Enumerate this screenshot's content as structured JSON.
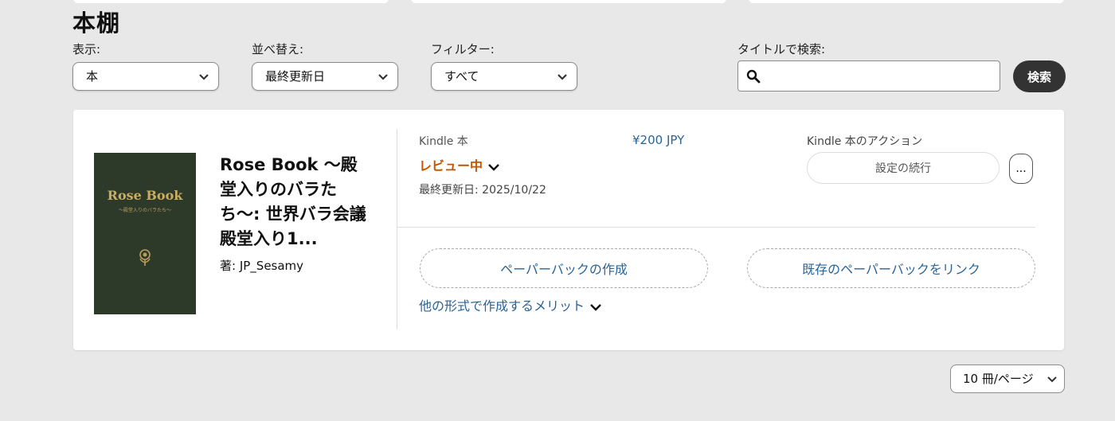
{
  "page_title": "本棚",
  "filters": {
    "display_label": "表示:",
    "display_value": "本",
    "sort_label": "並べ替え:",
    "sort_value": "最終更新日",
    "filter_label": "フィルター:",
    "filter_value": "すべて",
    "search_label": "タイトルで検索:",
    "search_value": "",
    "search_button": "検索"
  },
  "book": {
    "cover_title": "Rose Book",
    "cover_subtitle": "〜殿堂入りのバラたち〜",
    "title": "Rose Book 〜殿堂入りのバラたち〜: 世界バラ会議 殿堂入り1...",
    "author": "著: JP_Sesamy",
    "format": "Kindle 本",
    "price": "¥200 JPY",
    "status": "レビュー中",
    "last_updated": "最終更新日: 2025/10/22",
    "actions_label": "Kindle 本のアクション",
    "continue_button": "設定の続行",
    "more_button": "...",
    "create_paperback": "ペーパーバックの作成",
    "link_paperback": "既存のペーパーバックをリンク",
    "other_formats": "他の形式で作成するメリット"
  },
  "pagination": {
    "per_page": "10 冊/ページ"
  },
  "colors": {
    "status": "#c45500",
    "link": "#2a6496",
    "search_button_bg": "#333333",
    "cover_bg": "#2d3a2a",
    "cover_text": "#c9ad62"
  }
}
